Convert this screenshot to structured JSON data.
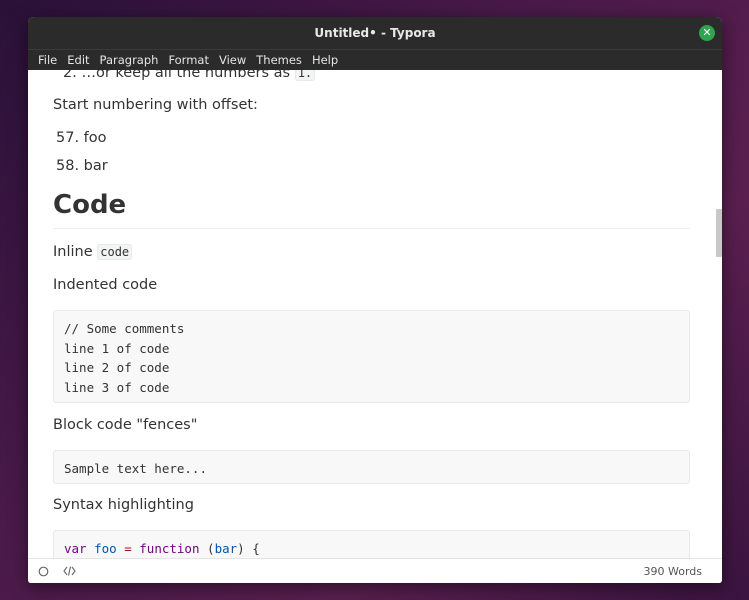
{
  "window": {
    "title": "Untitled• - Typora"
  },
  "menu": [
    "File",
    "Edit",
    "Paragraph",
    "Format",
    "View",
    "Themes",
    "Help"
  ],
  "doc": {
    "list_tail_prefix": "2.  …or keep all the numbers as ",
    "list_tail_code": "1.",
    "offset_heading": "Start numbering with offset:",
    "offset_items": [
      {
        "num": "57.",
        "text": "foo"
      },
      {
        "num": "58.",
        "text": "bar"
      }
    ],
    "code_heading": "Code",
    "inline_label": "Inline ",
    "inline_code": "code",
    "indented_label": "Indented code",
    "indented_lines": [
      "// Some comments",
      "line 1 of code",
      "line 2 of code",
      "line 3 of code"
    ],
    "fences_label": "Block code \"fences\"",
    "fences_line": "Sample text here...",
    "syntax_label": "Syntax highlighting",
    "syntax_tokens": {
      "kw1": "var",
      "name": "foo",
      "eq": "=",
      "kw2": "function",
      "lp": "(",
      "param": "bar",
      "rp": ") {"
    }
  },
  "status": {
    "word_count": "390 Words"
  },
  "colors": {
    "close": "#2ea44f",
    "titlebar": "#2b2b2b"
  }
}
